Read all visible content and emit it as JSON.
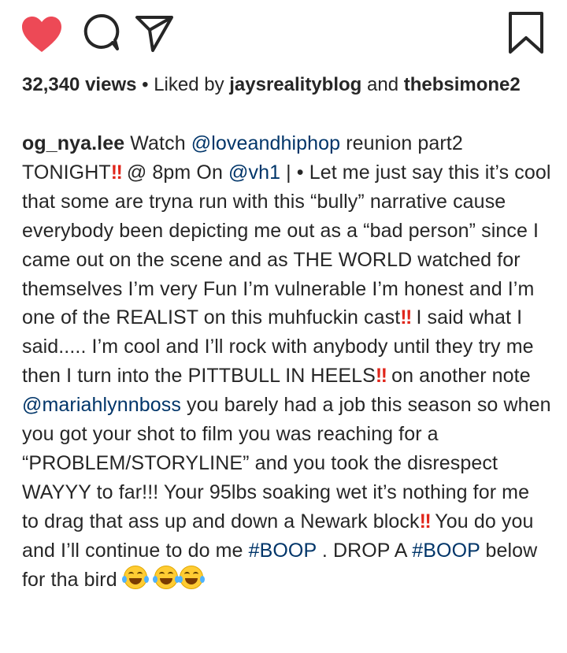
{
  "actions": {
    "like_icon": "heart-filled-icon",
    "comment_icon": "comment-bubble-icon",
    "share_icon": "paper-plane-icon",
    "save_icon": "bookmark-icon",
    "like_color": "#ed4956"
  },
  "stats": {
    "views": "32,340 views",
    "separator": " • Liked by ",
    "liker1": "jaysrealityblog",
    "and": " and ",
    "liker2": "thebsimone2"
  },
  "caption": {
    "username": "og_nya.lee",
    "t1": " Watch ",
    "m1": "@loveandhiphop",
    "t2": " reunion part2 TONIGHT",
    "t3": " @ 8pm On ",
    "m2": "@vh1",
    "t4": " | • Let me just say this it’s cool that some are tryna run with this “bully” narrative cause everybody been depicting me out as a “bad person” since I came out on the scene and as THE WORLD watched for themselves I’m very Fun I’m vulnerable I’m honest and I’m one of the REALIST on this muhfuckin cast",
    "t5": " I said what I said..... I’m cool and I’ll rock with anybody until they try me then I turn into the PITTBULL IN HEELS",
    "t6": " on another note ",
    "m3": "@mariahlynnboss",
    "t7": " you barely had a job this season so when you got your shot to film you was reaching for a “PROBLEM/STORYLINE” and you took the disrespect WAYYY to far!!! Your 95lbs soaking wet it’s nothing for me to drag that ass up and down a Newark block",
    "t8": " You do you and I’ll continue to do me ",
    "h1": "#BOOP",
    "t9": " . DROP A ",
    "h2": "#BOOP",
    "t10": " below for tha bird ",
    "bang": "‼",
    "emoji_name": "face-with-tears-of-joy-icon"
  }
}
